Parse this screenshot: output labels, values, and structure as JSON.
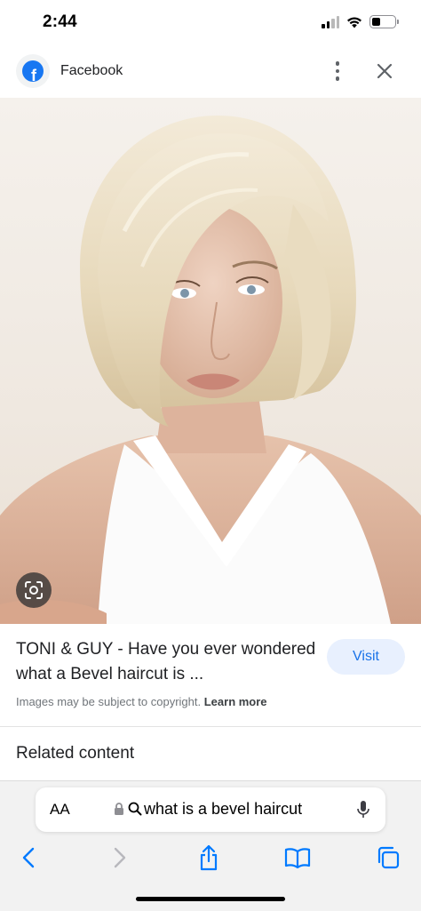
{
  "status_bar": {
    "time": "2:44"
  },
  "source": {
    "name": "Facebook"
  },
  "result": {
    "title": "TONI & GUY - Have you ever wondered what a Bevel haircut is ...",
    "visit_label": "Visit",
    "copyright_text": "Images may be subject to copyright.",
    "learn_more_label": "Learn more"
  },
  "related": {
    "heading": "Related content"
  },
  "browser": {
    "text_size_label": "AA",
    "address_text": "what is a bevel haircut"
  },
  "colors": {
    "facebook_blue": "#1877f2",
    "link_blue": "#1a73e8",
    "visit_bg": "#e8f0fe",
    "ios_blue": "#007aff"
  },
  "icons": [
    "facebook-icon",
    "more-vert-icon",
    "close-icon",
    "lens-icon",
    "lock-icon",
    "search-icon",
    "mic-icon",
    "back-icon",
    "forward-icon",
    "share-icon",
    "bookmarks-icon",
    "tabs-icon"
  ]
}
